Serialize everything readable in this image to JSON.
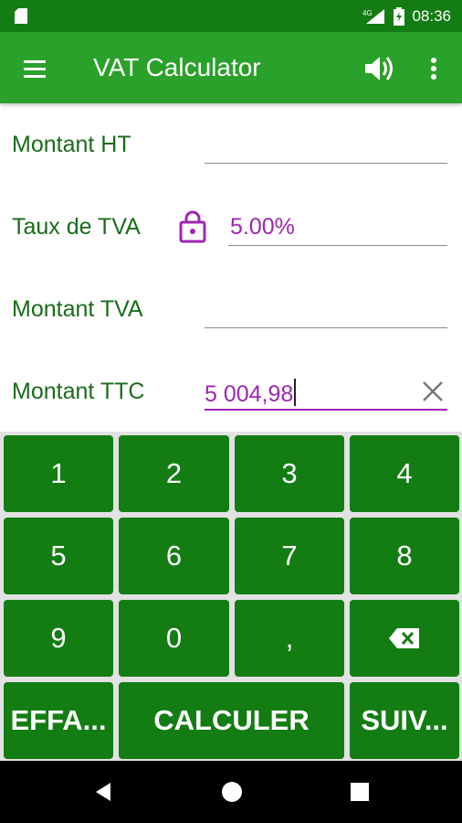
{
  "status_bar": {
    "network": "4G",
    "time": "08:36"
  },
  "app_bar": {
    "title": "VAT Calculator",
    "menu_icon": "hamburger-menu-icon",
    "volume_icon": "volume-icon",
    "more_icon": "more-vert-icon"
  },
  "form": {
    "montant_ht": {
      "label": "Montant HT",
      "value": ""
    },
    "taux_tva": {
      "label": "Taux de TVA",
      "value": "5.00%",
      "icon": "lock-icon"
    },
    "montant_tva": {
      "label": "Montant TVA",
      "value": ""
    },
    "montant_ttc": {
      "label": "Montant TTC",
      "value": "5 004,98",
      "clear_icon": "clear-icon"
    }
  },
  "keypad": {
    "digits": [
      "1",
      "2",
      "3",
      "4",
      "5",
      "6",
      "7",
      "8",
      "9",
      "0"
    ],
    "comma": ",",
    "backspace_icon": "backspace-icon",
    "clear_label": "EFFA...",
    "calculate_label": "CALCULER",
    "next_label": "SUIV..."
  },
  "colors": {
    "status_bar": "#137d13",
    "app_bar": "#2aa12a",
    "key": "#137d13",
    "label": "#1b6b1b",
    "accent": "#9c27b0"
  }
}
